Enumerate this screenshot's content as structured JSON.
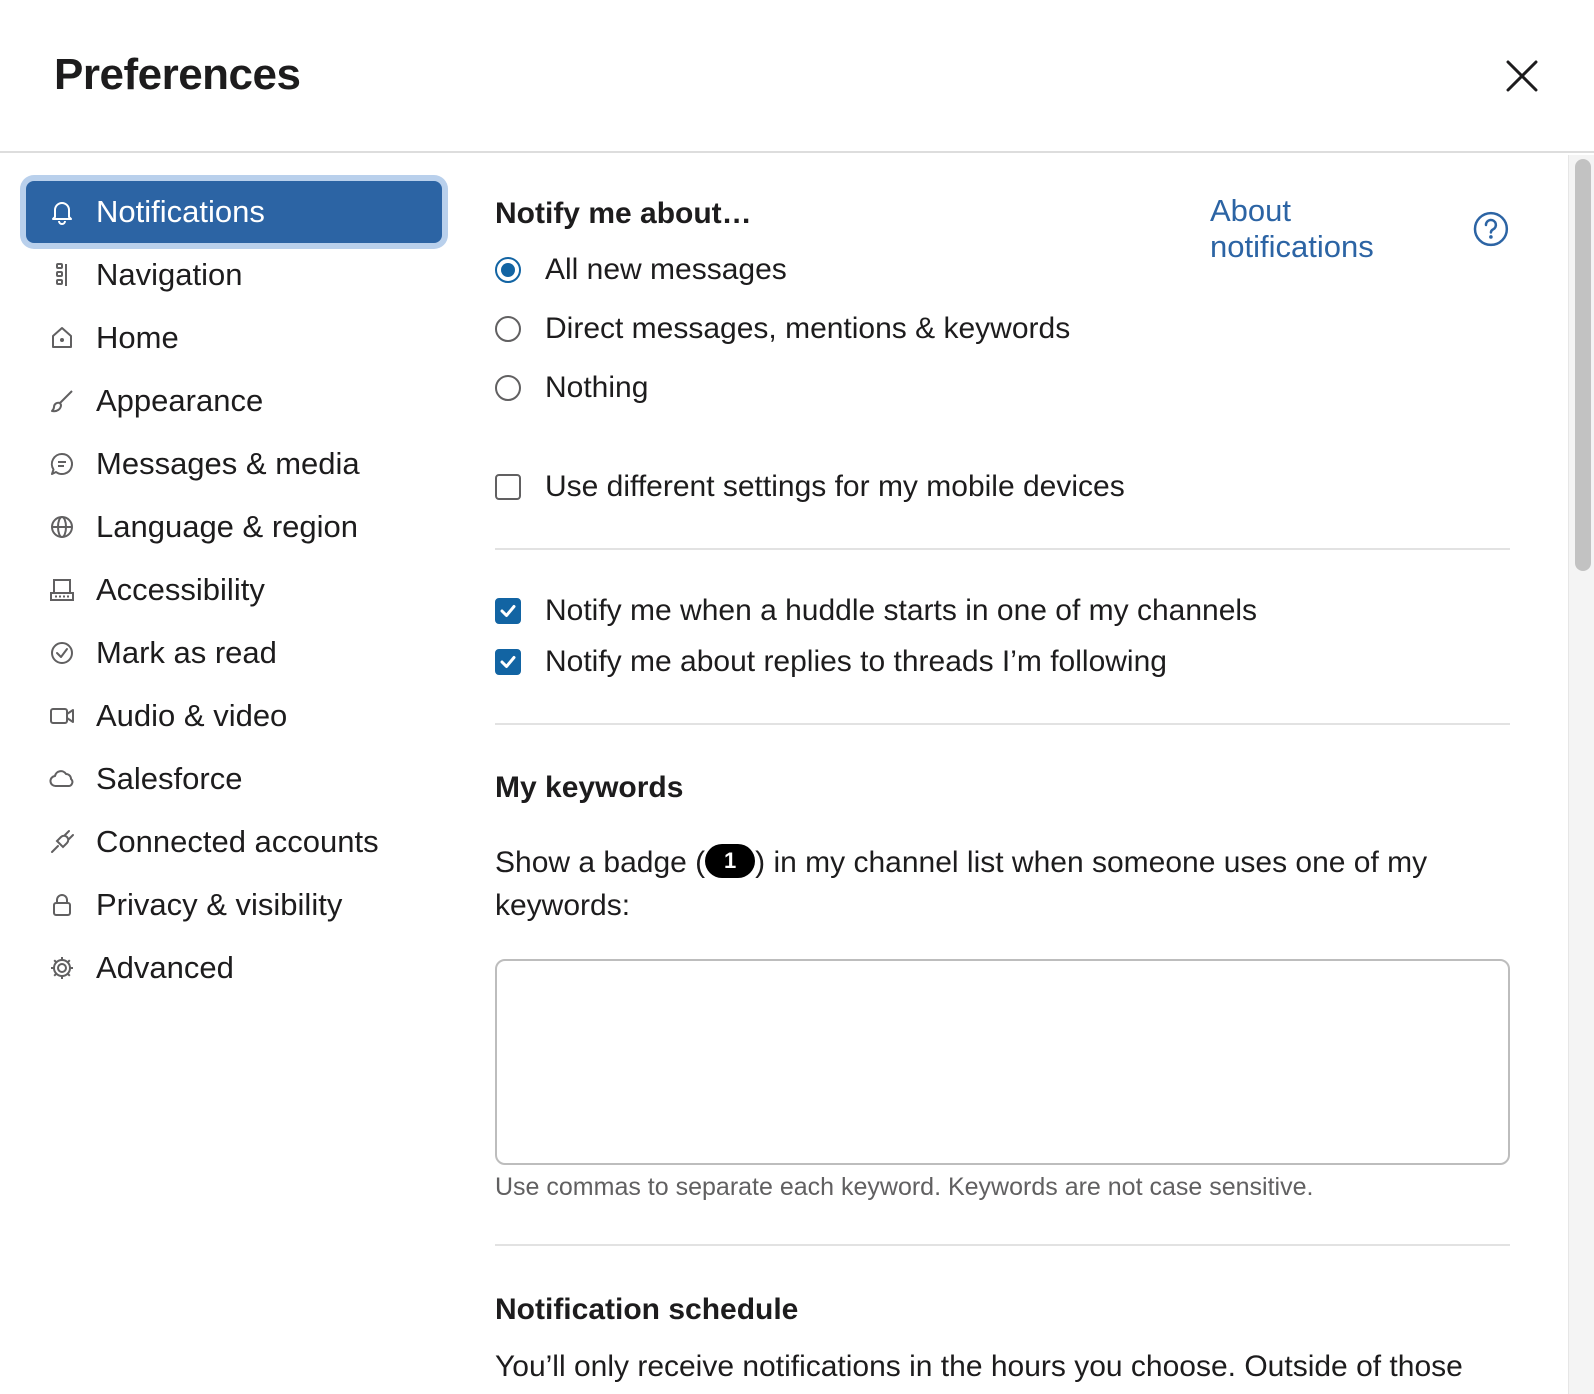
{
  "dialog": {
    "title": "Preferences",
    "close_icon": "close-icon"
  },
  "sidebar": {
    "items": [
      {
        "label": "Notifications",
        "icon": "bell-icon",
        "active": true
      },
      {
        "label": "Navigation",
        "icon": "navigation-icon"
      },
      {
        "label": "Home",
        "icon": "home-icon"
      },
      {
        "label": "Appearance",
        "icon": "paintbrush-icon"
      },
      {
        "label": "Messages & media",
        "icon": "message-icon"
      },
      {
        "label": "Language & region",
        "icon": "globe-icon"
      },
      {
        "label": "Accessibility",
        "icon": "keyboard-icon"
      },
      {
        "label": "Mark as read",
        "icon": "check-circle-icon"
      },
      {
        "label": "Audio & video",
        "icon": "video-icon"
      },
      {
        "label": "Salesforce",
        "icon": "cloud-icon"
      },
      {
        "label": "Connected accounts",
        "icon": "plug-icon"
      },
      {
        "label": "Privacy & visibility",
        "icon": "lock-icon"
      },
      {
        "label": "Advanced",
        "icon": "gear-icon"
      }
    ],
    "active_color": "#2c64a4"
  },
  "notify": {
    "title": "Notify me about…",
    "about_link": "About notifications",
    "about_icon": "help-circle-icon",
    "options": [
      {
        "label": "All new messages",
        "checked": true
      },
      {
        "label": "Direct messages, mentions & keywords",
        "checked": false
      },
      {
        "label": "Nothing",
        "checked": false
      }
    ],
    "mobile_checkbox": {
      "label": "Use different settings for my mobile devices",
      "checked": false
    }
  },
  "extras": {
    "huddle": {
      "label": "Notify me when a huddle starts in one of my channels",
      "checked": true
    },
    "threads": {
      "label": "Notify me about replies to threads I’m following",
      "checked": true
    }
  },
  "keywords": {
    "title": "My keywords",
    "description_before": "Show a badge (",
    "badge": "1",
    "description_after": ") in my channel list when someone uses one of my keywords:",
    "value": "",
    "hint": "Use commas to separate each keyword. Keywords are not case sensitive."
  },
  "schedule": {
    "title": "Notification schedule",
    "description": "You’ll only receive notifications in the hours you choose. Outside of those"
  },
  "colors": {
    "accent": "#1264a3",
    "link": "#2c64a4"
  }
}
